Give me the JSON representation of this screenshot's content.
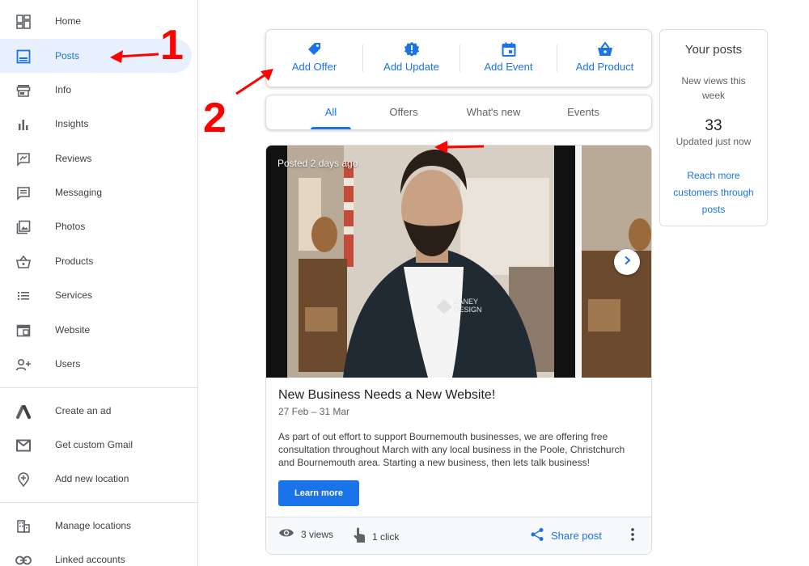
{
  "sidebar": {
    "items": [
      {
        "label": "Home",
        "icon": "dashboard-icon"
      },
      {
        "label": "Posts",
        "icon": "posts-icon",
        "active": true
      },
      {
        "label": "Info",
        "icon": "storefront-icon"
      },
      {
        "label": "Insights",
        "icon": "bar-chart-icon"
      },
      {
        "label": "Reviews",
        "icon": "reviews-icon"
      },
      {
        "label": "Messaging",
        "icon": "message-icon"
      },
      {
        "label": "Photos",
        "icon": "photos-icon"
      },
      {
        "label": "Products",
        "icon": "basket-icon"
      },
      {
        "label": "Services",
        "icon": "list-icon"
      },
      {
        "label": "Website",
        "icon": "website-icon"
      },
      {
        "label": "Users",
        "icon": "add-user-icon"
      }
    ],
    "secondary": [
      {
        "label": "Create an ad",
        "icon": "google-ads-icon"
      },
      {
        "label": "Get custom Gmail",
        "icon": "gmail-icon"
      },
      {
        "label": "Add new location",
        "icon": "add-location-icon"
      }
    ],
    "tertiary": [
      {
        "label": "Manage locations",
        "icon": "building-icon"
      },
      {
        "label": "Linked accounts",
        "icon": "link-icon"
      }
    ]
  },
  "actions": [
    {
      "label": "Add Offer",
      "icon": "tag-icon"
    },
    {
      "label": "Add Update",
      "icon": "update-badge-icon"
    },
    {
      "label": "Add Event",
      "icon": "calendar-icon"
    },
    {
      "label": "Add Product",
      "icon": "basket-icon"
    }
  ],
  "tabs": [
    {
      "label": "All",
      "active": true
    },
    {
      "label": "Offers"
    },
    {
      "label": "What's new"
    },
    {
      "label": "Events"
    }
  ],
  "post": {
    "meta": "Posted 2 days ago",
    "image_alt": "Man wearing a jacket with ZANEY DESIGN logo",
    "logo_text_1": "ZANEY",
    "logo_text_2": "DESIGN",
    "title": "New Business Needs a New Website!",
    "dates": "27 Feb – 31 Mar",
    "body": "As part of out effort to support Bournemouth businesses, we are offering free consultation throughout March with any local business in the Poole, Christchurch and Bournemouth area. Starting a new business, then lets talk business!",
    "cta": "Learn more",
    "views": "3 views",
    "clicks": "1 click",
    "share": "Share post"
  },
  "stats": {
    "title": "Your posts",
    "subtitle": "New views this week",
    "count": "33",
    "updated": "Updated just now",
    "link": "Reach more customers through posts"
  },
  "annotations": {
    "one": "1",
    "two": "2"
  },
  "colors": {
    "accent": "#1a73e8",
    "active_bg": "#e8f0fe",
    "annotation": "#ff0000"
  }
}
